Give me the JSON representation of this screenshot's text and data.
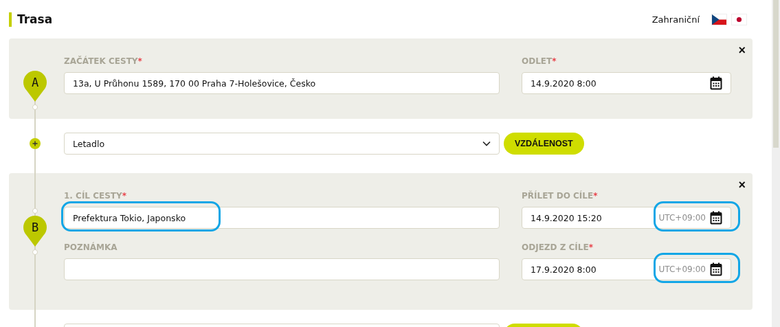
{
  "header": {
    "title": "Trasa",
    "trip_type": "Zahraniční",
    "flags": [
      {
        "kind": "cz"
      },
      {
        "kind": "jp"
      }
    ]
  },
  "route": [
    {
      "kind": "stop",
      "letter": "A",
      "close": "×",
      "place": {
        "label": "ZAČÁTEK CESTY",
        "mark": "*",
        "value": "13a, U Průhonu 1589, 170 00 Praha 7-Holešovice, Česko",
        "highlighted": false
      },
      "times": [
        {
          "label": "ODLET",
          "mark": "*",
          "value": "14.9.2020 8:00",
          "highlighted": false
        }
      ]
    },
    {
      "kind": "segment",
      "mode": "Letadlo",
      "button": "VZDÁLENOST"
    },
    {
      "kind": "stop",
      "letter": "B",
      "close": "×",
      "place": {
        "label": "1. CÍL CESTY",
        "mark": "*",
        "value": "Prefektura Tokio, Japonsko",
        "highlighted": true
      },
      "note": {
        "label": "POZNÁMKA"
      },
      "times": [
        {
          "label": "PŘÍLET DO CÍLE",
          "mark": "*",
          "value": "14.9.2020 15:20",
          "timezone": "UTC+09:00",
          "highlighted": true
        },
        {
          "label": "ODJEZD Z CÍLE",
          "mark": "*",
          "value": "17.9.2020 8:00",
          "timezone": "UTC+09:00",
          "highlighted": true
        }
      ]
    },
    {
      "kind": "segment"
    }
  ]
}
